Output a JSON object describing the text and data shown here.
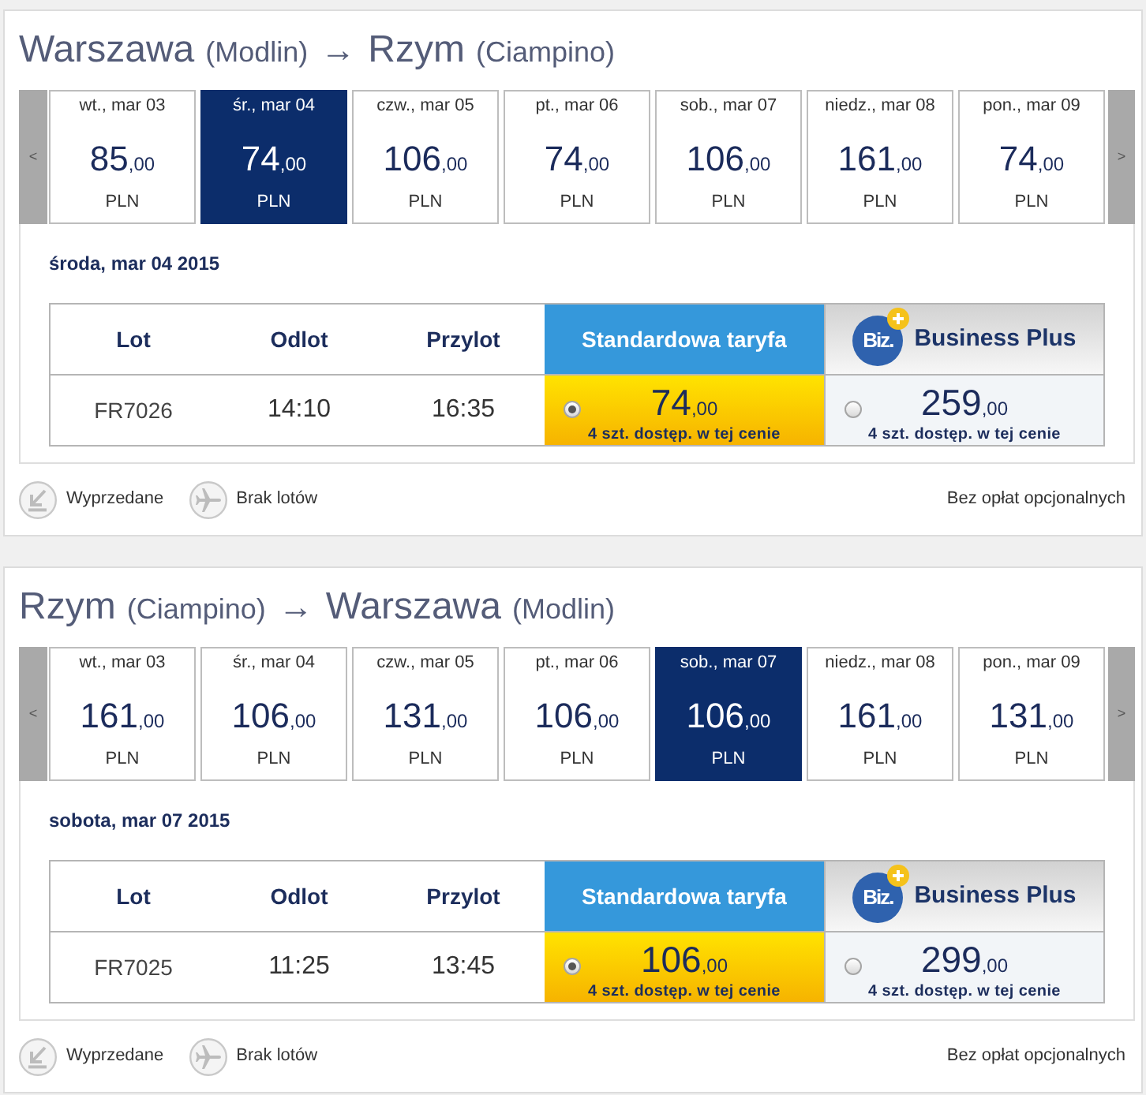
{
  "legs": [
    {
      "route": {
        "origin": "Warszawa",
        "origin_airport": "(Modlin)",
        "arrow": "→",
        "destination": "Rzym",
        "destination_airport": "(Ciampino)"
      },
      "prev": "<",
      "next": ">",
      "dates": [
        {
          "day": "wt., mar 03",
          "amount": "85",
          "cents": ",00",
          "currency": "PLN",
          "selected": false
        },
        {
          "day": "śr., mar 04",
          "amount": "74",
          "cents": ",00",
          "currency": "PLN",
          "selected": true
        },
        {
          "day": "czw., mar 05",
          "amount": "106",
          "cents": ",00",
          "currency": "PLN",
          "selected": false
        },
        {
          "day": "pt., mar 06",
          "amount": "74",
          "cents": ",00",
          "currency": "PLN",
          "selected": false
        },
        {
          "day": "sob., mar 07",
          "amount": "106",
          "cents": ",00",
          "currency": "PLN",
          "selected": false
        },
        {
          "day": "niedz., mar 08",
          "amount": "161",
          "cents": ",00",
          "currency": "PLN",
          "selected": false
        },
        {
          "day": "pon., mar 09",
          "amount": "74",
          "cents": ",00",
          "currency": "PLN",
          "selected": false
        }
      ],
      "date_heading": "środa, mar 04 2015",
      "table": {
        "columns": [
          {
            "kind": "plain",
            "label": "Lot"
          },
          {
            "kind": "plain",
            "label": "Odlot"
          },
          {
            "kind": "plain",
            "label": "Przylot"
          },
          {
            "kind": "standard",
            "label": "Standardowa taryfa"
          },
          {
            "kind": "business",
            "label": "Business Plus",
            "logo": "Biz."
          }
        ],
        "rows": [
          {
            "flight": "FR7026",
            "departure": "14:10",
            "arrival": "16:35",
            "fares": [
              {
                "amount": "74",
                "cents": ",00",
                "availability": "4 szt. dostęp. w tej cenie",
                "selected": true
              },
              {
                "amount": "259",
                "cents": ",00",
                "availability": "4 szt. dostęp. w tej cenie",
                "selected": false
              }
            ]
          }
        ]
      },
      "legend": [
        {
          "kind": "sold_out",
          "label": "Wyprzedane"
        },
        {
          "kind": "no_flights",
          "label": "Brak lotów"
        }
      ],
      "note": "Bez opłat opcjonalnych"
    },
    {
      "route": {
        "origin": "Rzym",
        "origin_airport": "(Ciampino)",
        "arrow": "→",
        "destination": "Warszawa",
        "destination_airport": "(Modlin)"
      },
      "prev": "<",
      "next": ">",
      "dates": [
        {
          "day": "wt., mar 03",
          "amount": "161",
          "cents": ",00",
          "currency": "PLN",
          "selected": false
        },
        {
          "day": "śr., mar 04",
          "amount": "106",
          "cents": ",00",
          "currency": "PLN",
          "selected": false
        },
        {
          "day": "czw., mar 05",
          "amount": "131",
          "cents": ",00",
          "currency": "PLN",
          "selected": false
        },
        {
          "day": "pt., mar 06",
          "amount": "106",
          "cents": ",00",
          "currency": "PLN",
          "selected": false
        },
        {
          "day": "sob., mar 07",
          "amount": "106",
          "cents": ",00",
          "currency": "PLN",
          "selected": true
        },
        {
          "day": "niedz., mar 08",
          "amount": "161",
          "cents": ",00",
          "currency": "PLN",
          "selected": false
        },
        {
          "day": "pon., mar 09",
          "amount": "131",
          "cents": ",00",
          "currency": "PLN",
          "selected": false
        }
      ],
      "date_heading": "sobota, mar 07 2015",
      "table": {
        "columns": [
          {
            "kind": "plain",
            "label": "Lot"
          },
          {
            "kind": "plain",
            "label": "Odlot"
          },
          {
            "kind": "plain",
            "label": "Przylot"
          },
          {
            "kind": "standard",
            "label": "Standardowa taryfa"
          },
          {
            "kind": "business",
            "label": "Business Plus",
            "logo": "Biz."
          }
        ],
        "rows": [
          {
            "flight": "FR7025",
            "departure": "11:25",
            "arrival": "13:45",
            "fares": [
              {
                "amount": "106",
                "cents": ",00",
                "availability": "4 szt. dostęp. w tej cenie",
                "selected": true
              },
              {
                "amount": "299",
                "cents": ",00",
                "availability": "4 szt. dostęp. w tej cenie",
                "selected": false
              }
            ]
          }
        ]
      },
      "legend": [
        {
          "kind": "sold_out",
          "label": "Wyprzedane"
        },
        {
          "kind": "no_flights",
          "label": "Brak lotów"
        }
      ],
      "note": "Bez opłat opcjonalnych"
    }
  ]
}
